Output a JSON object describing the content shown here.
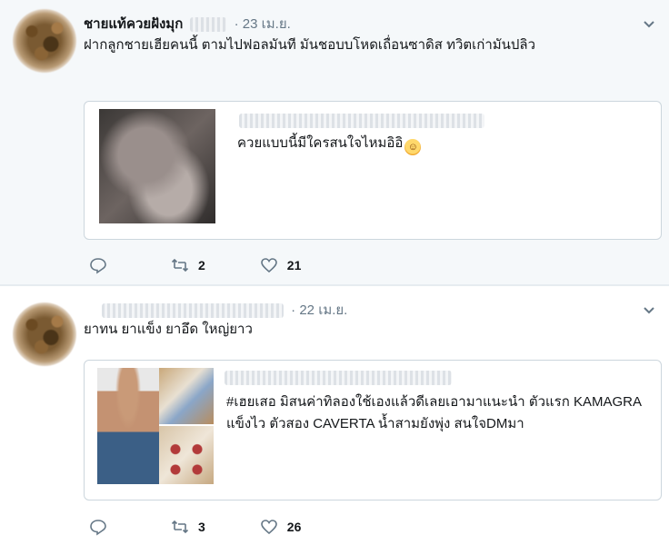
{
  "tweets": [
    {
      "name": "ชายแท้ควยฝังมุก",
      "time": "23 เม.ย.",
      "text": "ฝากลูกชายเฮียคนนี้ ตามไปฟอลมันที มันชอบบโหดเถื่อนซาดิส ทวิตเก่ามันปลิว",
      "quote_text": "ควยแบบนี้มีใครสนใจไหมอิอิ",
      "quote_emoji": "smiling-face-emoji",
      "retweets": "2",
      "likes": "21"
    },
    {
      "name": "",
      "time": "22 เม.ย.",
      "text": "ยาทน ยาแข็ง ยาอึด ใหญ่ยาว",
      "quote_text": "#เฮยเสอ มิสนค่าทิลองใช้เองแล้วดีเลยเอามาแนะนำ ตัวแรก KAMAGRA แข็งไว ตัวสอง CAVERTA น้ำสามยังพุ่ง สนใจDMมา",
      "retweets": "3",
      "likes": "26"
    }
  ],
  "colors": {
    "muted": "#657786",
    "bg_first": "#f5f8fa",
    "border": "#ccd6dd"
  }
}
